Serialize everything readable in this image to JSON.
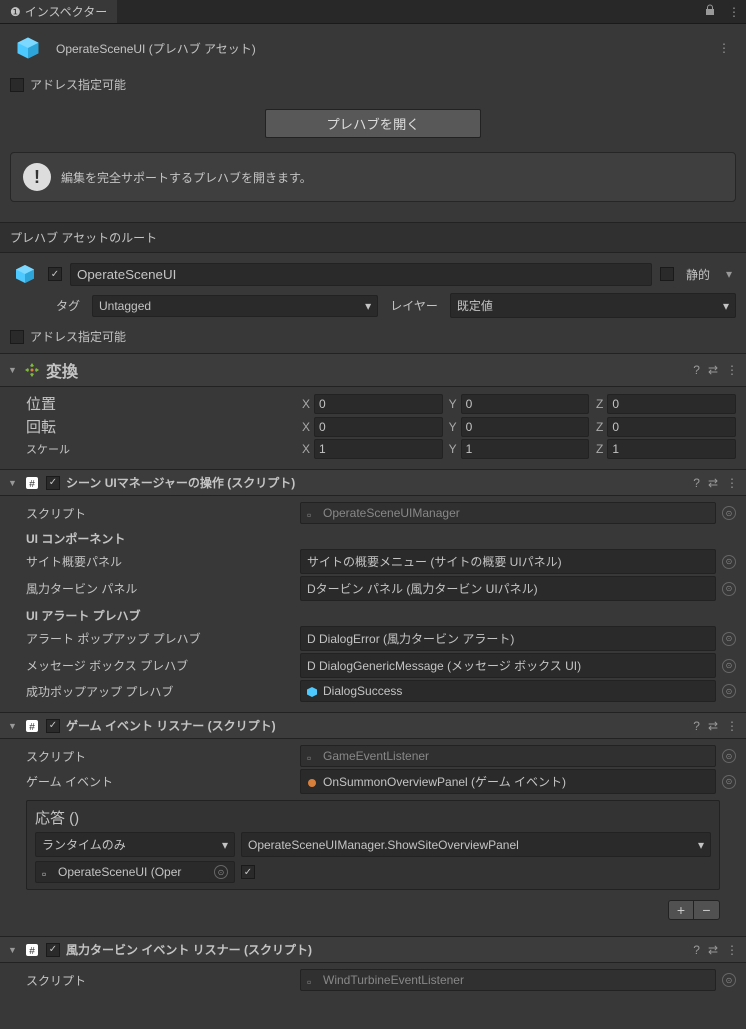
{
  "tab": {
    "title": "インスペクター"
  },
  "header": {
    "asset_name": "OperateSceneUI  (プレハブ アセット)",
    "addressable_label": "アドレス指定可能",
    "open_prefab": "プレハブを開く",
    "info_text": "編集を完全サポートするプレハブを開きます。"
  },
  "root_label": "プレハブ アセットのルート",
  "go": {
    "name": "OperateSceneUI",
    "static_label": "静的",
    "tag_label": "タグ",
    "tag_value": "Untagged",
    "layer_label": "レイヤー",
    "layer_value": "既定値",
    "addressable_label": "アドレス指定可能"
  },
  "transform": {
    "title": "変換",
    "position_label": "位置",
    "rotation_label": "回転",
    "scale_label": "スケール",
    "position": {
      "x": "0",
      "y": "0",
      "z": "0"
    },
    "rotation": {
      "x": "0",
      "y": "0",
      "z": "0"
    },
    "scale": {
      "x": "1",
      "y": "1",
      "z": "1"
    }
  },
  "comp1": {
    "title": "シーン UIマネージャーの操作 (スクリプト)",
    "script_label": "スクリプト",
    "script_value": "OperateSceneUIManager",
    "section_ui": "UI コンポーネント",
    "site_panel_label": "サイト概要パネル",
    "site_panel_value": "サイトの概要メニュー (サイトの概要 UIパネル)",
    "wind_panel_label": "風力タービン パネル",
    "wind_panel_value": "Dタービン パネル (風力タービン UIパネル)",
    "section_alert": "UI アラート プレハブ",
    "alert_label": "アラート ポップアップ プレハブ",
    "alert_value": "D DialogError (風力タービン アラート)",
    "msg_label": "メッセージ ボックス プレハブ",
    "msg_value": "D DialogGenericMessage (メッセージ ボックス UI)",
    "success_label": "成功ポップアップ プレハブ",
    "success_value": "DialogSuccess"
  },
  "comp2": {
    "title": "ゲーム イベント リスナー (スクリプト)",
    "script_label": "スクリプト",
    "script_value": "GameEventListener",
    "event_label": "ゲーム イベント",
    "event_value": "OnSummonOverviewPanel (ゲーム イベント)",
    "response_title": "応答 ()",
    "runtime_only": "ランタイムのみ",
    "method": "OperateSceneUIManager.ShowSiteOverviewPanel",
    "target": "OperateSceneUI (Oper"
  },
  "comp3": {
    "title": "風力タービン イベント リスナー (スクリプト)",
    "script_label": "スクリプト",
    "script_value": "WindTurbineEventListener"
  }
}
